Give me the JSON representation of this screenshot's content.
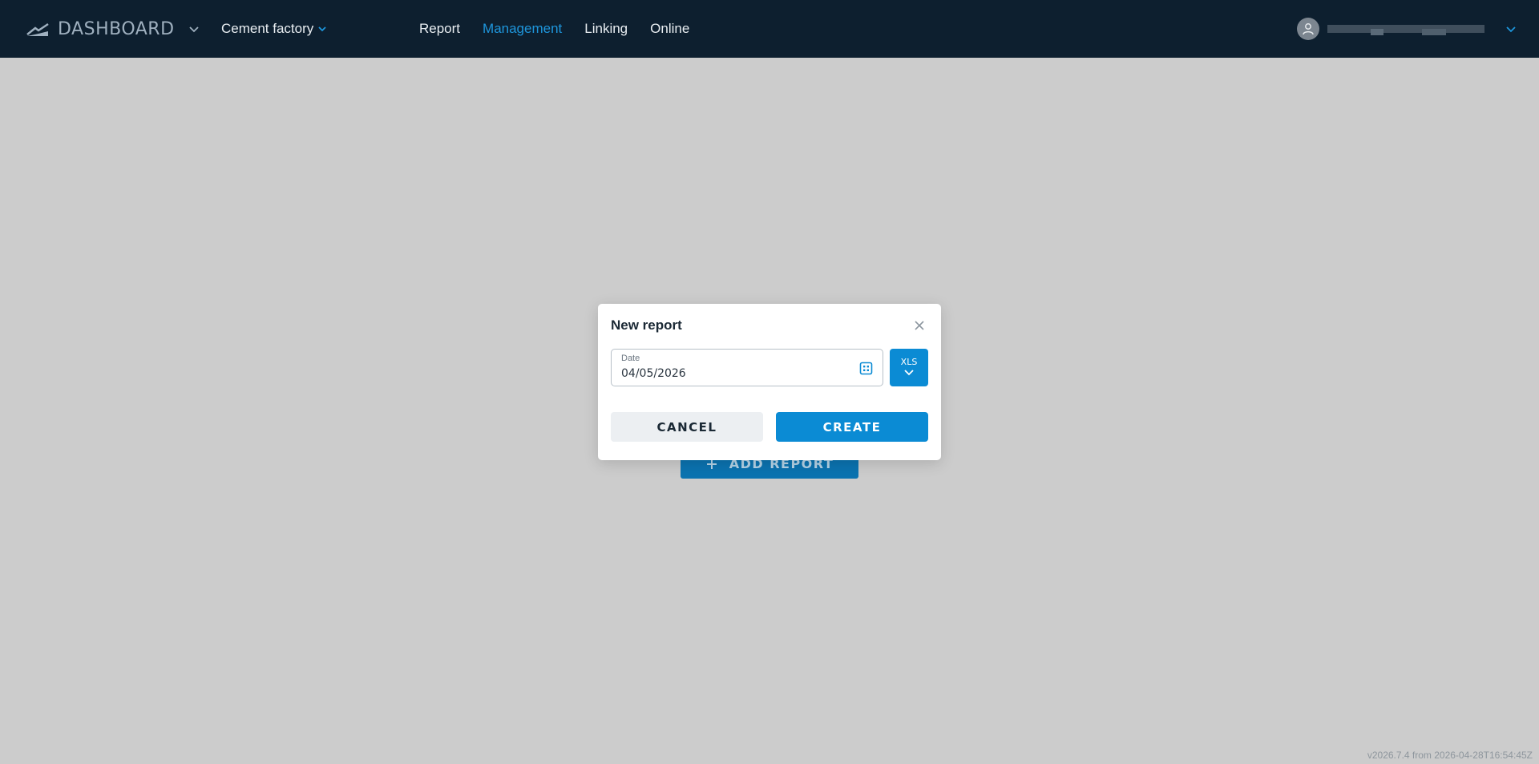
{
  "header": {
    "brand": "DASHBOARD",
    "site": "Cement factory",
    "nav": [
      {
        "label": "Report",
        "active": false
      },
      {
        "label": "Management",
        "active": true
      },
      {
        "label": "Linking",
        "active": false
      },
      {
        "label": "Online",
        "active": false
      }
    ],
    "colors": {
      "background": "#0d1f2f",
      "accent": "#1e96dc"
    }
  },
  "page": {
    "add_report_label": "ADD REPORT"
  },
  "modal": {
    "title": "New report",
    "date_label": "Date",
    "date_value": "04/05/2026",
    "format": "XLS",
    "cancel_label": "CANCEL",
    "create_label": "CREATE",
    "colors": {
      "primary": "#0b8bd4"
    }
  },
  "footer": {
    "version": "v2026.7.4 from 2026-04-28T16:54:45Z"
  }
}
